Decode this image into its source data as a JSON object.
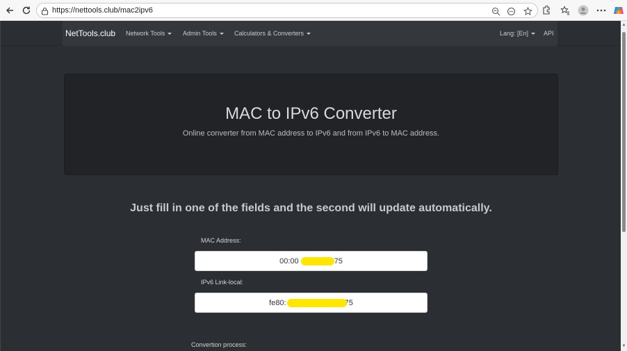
{
  "browser": {
    "url": "https://nettools.club/mac2ipv6",
    "icons": [
      "back-icon",
      "reload-icon",
      "lock-icon",
      "zoom-icon",
      "reader-icon",
      "favorite-icon",
      "extensions-icon",
      "favorites-icon",
      "profile-icon",
      "more-icon",
      "copilot-icon"
    ]
  },
  "navbar": {
    "brand": "NetTools.club",
    "items": [
      {
        "label": "Network Tools"
      },
      {
        "label": "Admin Tools"
      },
      {
        "label": "Calculators & Converters"
      }
    ],
    "lang": "Lang: [En]",
    "api": "API"
  },
  "hero": {
    "title": "MAC to IPv6 Converter",
    "subtitle": "Online converter from MAC address to IPv6 and from IPv6 to MAC address."
  },
  "instruction": "Just fill in one of the fields and the second will update automatically.",
  "form": {
    "mac_label": "MAC Address:",
    "mac_value_start": "00:00",
    "mac_value_end": ":75",
    "ipv6_label": "IPv6 Link-local:",
    "ipv6_value_start": "fe80:",
    "ipv6_value_end": "75",
    "process_label": "Convertion process:"
  },
  "colors": {
    "page_bg": "#2b2e33",
    "navbar_bg": "#34373c",
    "hero_bg": "#212327",
    "redaction": "#ffe600"
  }
}
